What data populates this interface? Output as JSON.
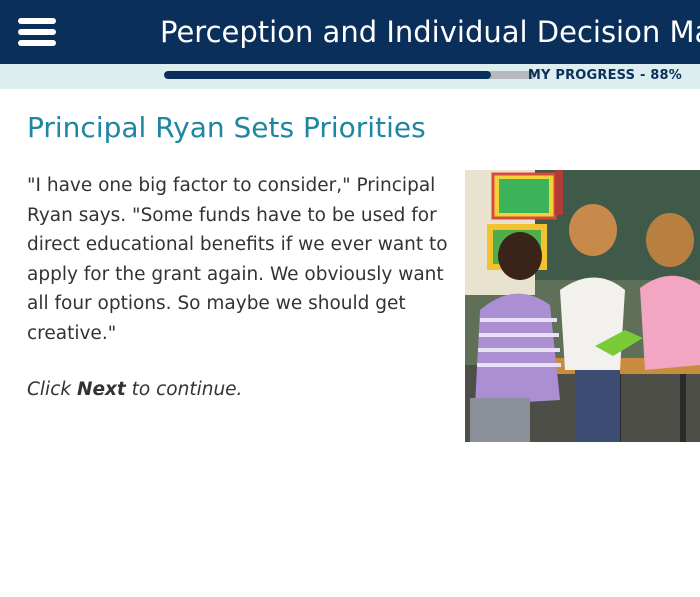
{
  "header": {
    "title": "Perception and Individual Decision Making",
    "menu_icon": "hamburger-menu-icon"
  },
  "progress": {
    "label": "MY PROGRESS - 88%",
    "percent": 88
  },
  "content": {
    "heading": "Principal Ryan Sets Priorities",
    "paragraph": "\"I have one big factor to consider,\" Principal Ryan says. \"Some funds have to be used for direct educational benefits if we ever want to apply for the grant again. We obviously want all four options. So maybe we should get creative.\"",
    "instruction_prefix": "Click ",
    "instruction_bold": "Next",
    "instruction_suffix": " to continue."
  },
  "colors": {
    "header_bg": "#0b2f5b",
    "accent": "#1e86a2",
    "strip_bg": "#dceef0"
  }
}
